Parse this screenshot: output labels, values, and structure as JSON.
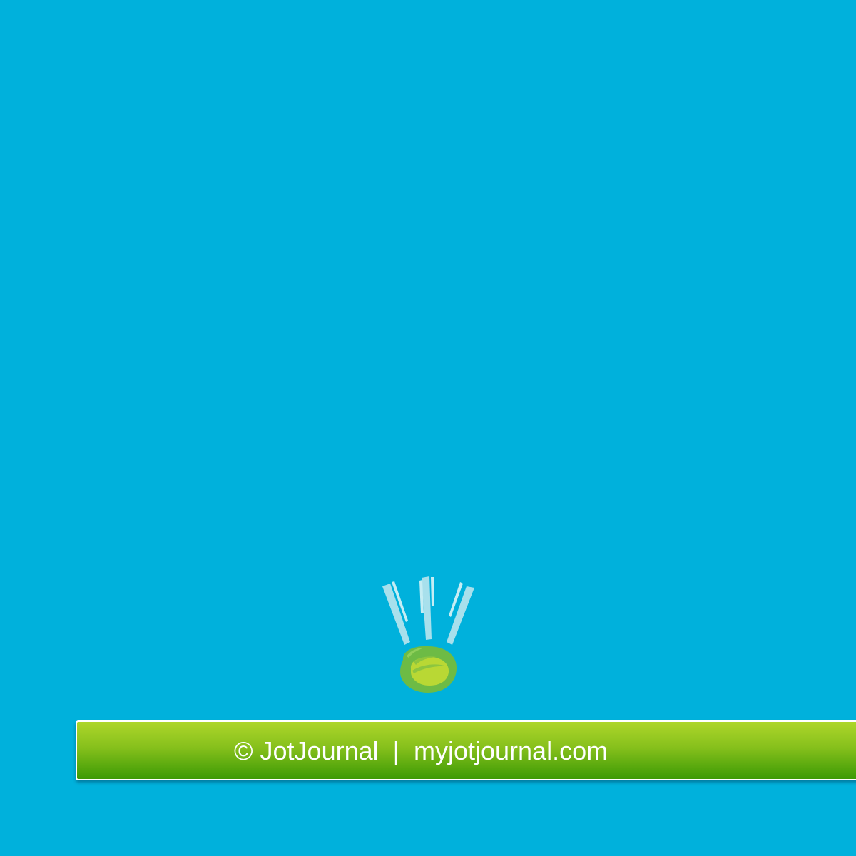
{
  "background": {
    "color": "#00b1dc"
  },
  "logo": {
    "icon": "exclamation-splash-icon",
    "ray_color": "#a8e0ec",
    "dot_outer_color": "#6dbb45",
    "dot_inner_color": "#b9d834"
  },
  "footer": {
    "text": "© JotJournal  |  myjotjournal.com",
    "gradient_top": "#aed62a",
    "gradient_bottom": "#3c9a05",
    "text_color": "#ffffff"
  }
}
